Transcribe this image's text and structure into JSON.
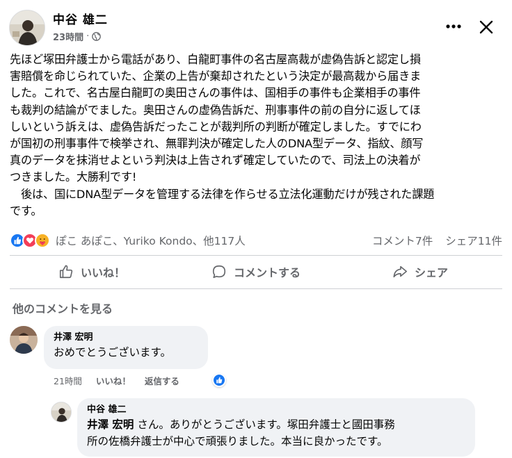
{
  "post": {
    "author": "中谷 雄二",
    "time": "23時間",
    "separator": "·",
    "privacy_icon": "globe-icon",
    "body": "先ほど塚田弁護士から電話があり、白龍町事件の名古屋高裁が虚偽告訴と認定し損\n害賠償を命じられていた、企業の上告が棄却されたという決定が最高裁から届きま\nした。これで、名古屋白龍町の奥田さんの事件は、国相手の事件も企業相手の事件\nも裁判の結論がでました。奥田さんの虚偽告訴だ、刑事事件の前の自分に返してほ\nしいという訴えは、虚偽告訴だったことが裁判所の判断が確定しました。すでにわ\nが国初の刑事事件で検挙され、無罪判決が確定した人のDNA型データ、指紋、顔写\n真のデータを抹消せよという判決は上告されず確定していたので、司法上の決着が\nつきました。大勝利です!\n　後は、国にDNA型データを管理する法律を作らせる立法化運動だけが残された課題\nです。"
  },
  "reactions": {
    "icons": [
      "like-icon",
      "love-icon",
      "care-icon"
    ],
    "reactors": "ぽこ あぽこ、Yuriko Kondo、他117人",
    "comments_count": "コメント7件",
    "shares_count": "シェア11件"
  },
  "actions": {
    "like": "いいね！",
    "comment": "コメントする",
    "share": "シェア"
  },
  "more_comments": "他のコメントを見る",
  "comments": [
    {
      "name": "井澤 宏明",
      "text": "おめでとうございます。",
      "time": "21時間",
      "like": "いいね！",
      "reply": "返信する"
    }
  ],
  "reply": {
    "name": "中谷 雄二",
    "mention": "井澤 宏明",
    "line1": " さん。ありがとうございます。塚田弁護士と國田事務",
    "line2": "所の佐橋弁護士が中心で頑張りました。本当に良かったです。"
  },
  "colors": {
    "accent": "#1877f2",
    "secondary_text": "#65676b",
    "bubble": "#f0f2f5"
  }
}
